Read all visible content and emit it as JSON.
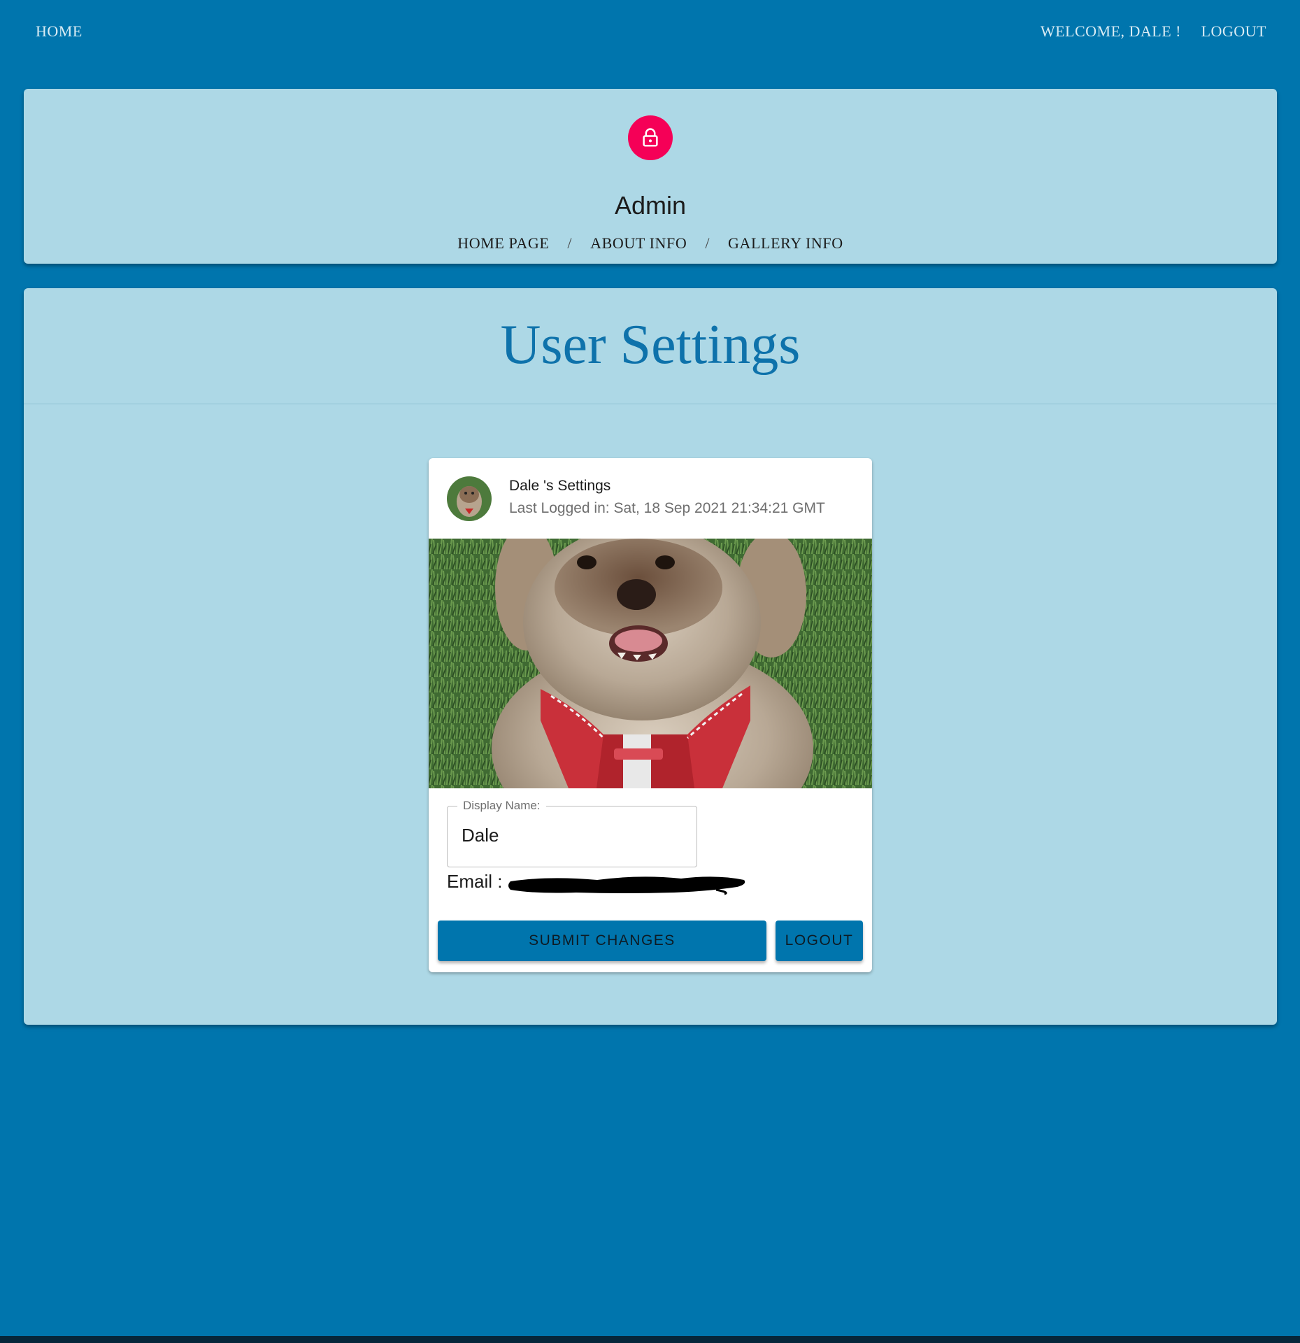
{
  "topnav": {
    "home_label": "HOME",
    "welcome_label": "WELCOME, DALE !",
    "logout_label": "LOGOUT"
  },
  "admin": {
    "icon": "lock-icon",
    "title": "Admin",
    "breadcrumb": [
      {
        "label": "HOME PAGE"
      },
      {
        "label": "ABOUT INFO"
      },
      {
        "label": "GALLERY INFO"
      }
    ],
    "separator": "/"
  },
  "settings": {
    "heading": "User Settings",
    "card": {
      "title": "Dale 's Settings",
      "subtitle": "Last Logged in: Sat, 18 Sep 2021 21:34:21 GMT",
      "display_name_label": "Display Name:",
      "display_name_value": "Dale",
      "email_label": "Email :",
      "submit_label": "SUBMIT CHANGES",
      "logout_label": "LOGOUT"
    }
  },
  "colors": {
    "page_background": "#0075ad",
    "panel_background": "#add8e6",
    "accent_pink": "#f50057",
    "heading_blue": "#0e72ab"
  }
}
